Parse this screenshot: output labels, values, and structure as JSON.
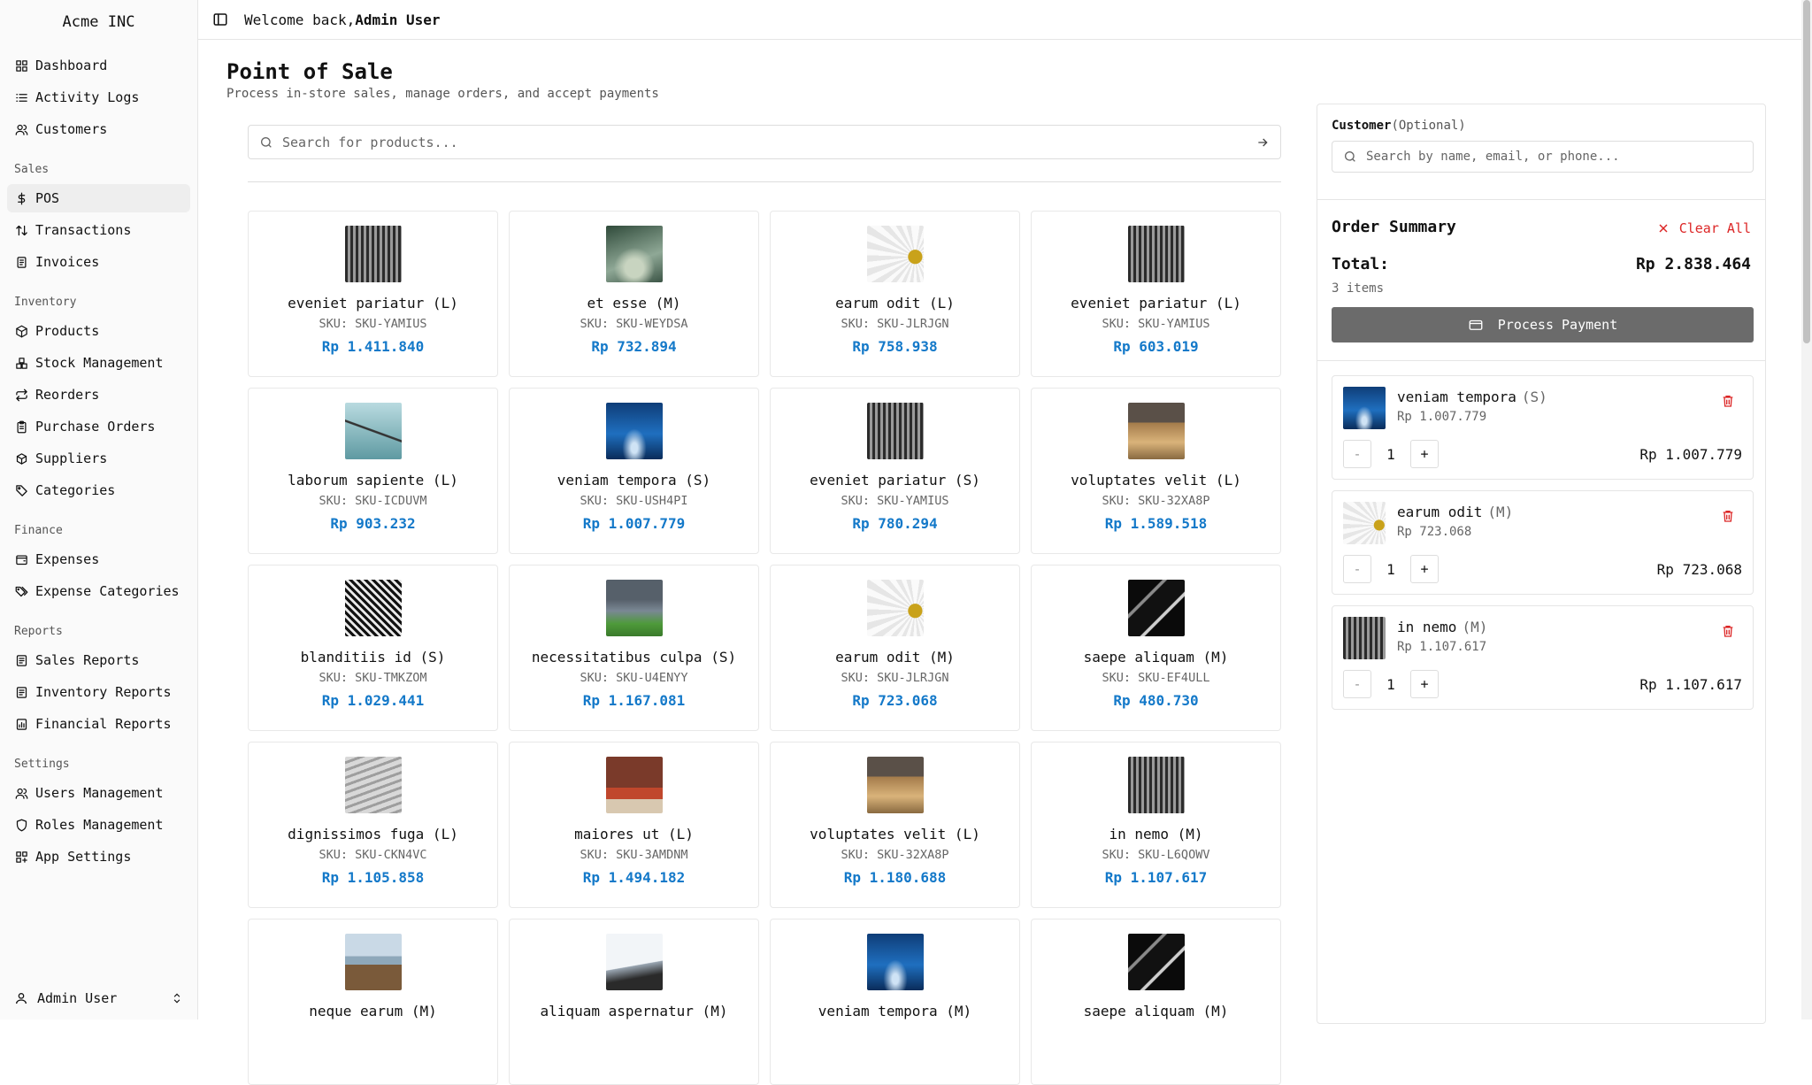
{
  "brand": "Acme INC",
  "header": {
    "welcome_prefix": "Welcome back,",
    "user": "Admin User"
  },
  "sidebar": {
    "top": [
      {
        "label": "Dashboard",
        "icon": "layout-grid-icon"
      },
      {
        "label": "Activity Logs",
        "icon": "list-icon"
      },
      {
        "label": "Customers",
        "icon": "users-icon"
      }
    ],
    "groups": [
      {
        "label": "Sales",
        "items": [
          {
            "label": "POS",
            "icon": "dollar-icon",
            "active": true
          },
          {
            "label": "Transactions",
            "icon": "arrows-updown-icon"
          },
          {
            "label": "Invoices",
            "icon": "file-text-icon"
          }
        ]
      },
      {
        "label": "Inventory",
        "items": [
          {
            "label": "Products",
            "icon": "package-icon"
          },
          {
            "label": "Stock Management",
            "icon": "boxes-icon"
          },
          {
            "label": "Reorders",
            "icon": "repeat-icon"
          },
          {
            "label": "Purchase Orders",
            "icon": "clipboard-icon"
          },
          {
            "label": "Suppliers",
            "icon": "truck-icon"
          },
          {
            "label": "Categories",
            "icon": "tag-icon"
          }
        ]
      },
      {
        "label": "Finance",
        "items": [
          {
            "label": "Expenses",
            "icon": "wallet-icon"
          },
          {
            "label": "Expense Categories",
            "icon": "tags-icon"
          }
        ]
      },
      {
        "label": "Reports",
        "items": [
          {
            "label": "Sales Reports",
            "icon": "report-icon"
          },
          {
            "label": "Inventory Reports",
            "icon": "report-icon"
          },
          {
            "label": "Financial Reports",
            "icon": "report-chart-icon"
          }
        ]
      },
      {
        "label": "Settings",
        "items": [
          {
            "label": "Users Management",
            "icon": "users-icon"
          },
          {
            "label": "Roles Management",
            "icon": "shield-icon"
          },
          {
            "label": "App Settings",
            "icon": "settings-icon"
          }
        ]
      }
    ],
    "footer_user": "Admin User"
  },
  "page": {
    "title": "Point of Sale",
    "subtitle": "Process in-store sales, manage orders, and accept payments",
    "search_placeholder": "Search for products..."
  },
  "products": [
    {
      "name": "eveniet pariatur (L)",
      "sku": "SKU: SKU-YAMIUS",
      "price": "Rp 1.411.840",
      "thumb": "building"
    },
    {
      "name": "et esse (M)",
      "sku": "SKU: SKU-WEYDSA",
      "price": "Rp 732.894",
      "thumb": "road"
    },
    {
      "name": "earum odit (L)",
      "sku": "SKU: SKU-JLRJGN",
      "price": "Rp 758.938",
      "thumb": "daisy"
    },
    {
      "name": "eveniet pariatur (L)",
      "sku": "SKU: SKU-YAMIUS",
      "price": "Rp 603.019",
      "thumb": "building"
    },
    {
      "name": "laborum sapiente (L)",
      "sku": "SKU: SKU-ICDUVM",
      "price": "Rp 903.232",
      "thumb": "cable"
    },
    {
      "name": "veniam tempora (S)",
      "sku": "SKU: SKU-USH4PI",
      "price": "Rp 1.007.779",
      "thumb": "ocean"
    },
    {
      "name": "eveniet pariatur (S)",
      "sku": "SKU: SKU-YAMIUS",
      "price": "Rp 780.294",
      "thumb": "building"
    },
    {
      "name": "voluptates velit (L)",
      "sku": "SKU: SKU-32XA8P",
      "price": "Rp 1.589.518",
      "thumb": "grass"
    },
    {
      "name": "blanditiis id (S)",
      "sku": "SKU: SKU-TMKZOM",
      "price": "Rp 1.029.441",
      "thumb": "steel"
    },
    {
      "name": "necessitatibus culpa (S)",
      "sku": "SKU: SKU-U4ENYY",
      "price": "Rp 1.167.081",
      "thumb": "field"
    },
    {
      "name": "earum odit (M)",
      "sku": "SKU: SKU-JLRJGN",
      "price": "Rp 723.068",
      "thumb": "daisy"
    },
    {
      "name": "saepe aliquam (M)",
      "sku": "SKU: SKU-EF4ULL",
      "price": "Rp 480.730",
      "thumb": "architecture"
    },
    {
      "name": "dignissimos fuga (L)",
      "sku": "SKU: SKU-CKN4VC",
      "price": "Rp 1.105.858",
      "thumb": "tower"
    },
    {
      "name": "maiores ut (L)",
      "sku": "SKU: SKU-3AMDNM",
      "price": "Rp 1.494.182",
      "thumb": "brick"
    },
    {
      "name": "voluptates velit (L)",
      "sku": "SKU: SKU-32XA8P",
      "price": "Rp 1.180.688",
      "thumb": "grass"
    },
    {
      "name": "in nemo (M)",
      "sku": "SKU: SKU-L6QOWV",
      "price": "Rp 1.107.617",
      "thumb": "building"
    },
    {
      "name": "neque earum (M)",
      "sku": "",
      "price": "",
      "thumb": "pier"
    },
    {
      "name": "aliquam aspernatur (M)",
      "sku": "",
      "price": "",
      "thumb": "sky"
    },
    {
      "name": "veniam tempora (M)",
      "sku": "",
      "price": "",
      "thumb": "ocean"
    },
    {
      "name": "saepe aliquam (M)",
      "sku": "",
      "price": "",
      "thumb": "architecture"
    }
  ],
  "customer": {
    "label": "Customer",
    "optional": "(Optional)",
    "placeholder": "Search by name, email, or phone..."
  },
  "order": {
    "title": "Order Summary",
    "clear_label": "Clear All",
    "total_label": "Total:",
    "total_value": "Rp 2.838.464",
    "items_count": "3 items",
    "pay_label": "Process Payment"
  },
  "cart": [
    {
      "name": "veniam tempora",
      "size": "(S)",
      "unit": "Rp 1.007.779",
      "qty": "1",
      "total": "Rp 1.007.779",
      "thumb": "ocean"
    },
    {
      "name": "earum odit",
      "size": "(M)",
      "unit": "Rp 723.068",
      "qty": "1",
      "total": "Rp 723.068",
      "thumb": "daisy"
    },
    {
      "name": "in nemo",
      "size": "(M)",
      "unit": "Rp 1.107.617",
      "qty": "1",
      "total": "Rp 1.107.617",
      "thumb": "building"
    }
  ],
  "colors": {
    "price": "#1479c9",
    "danger": "#dc2626",
    "pay_button": "#6b6b6b"
  }
}
